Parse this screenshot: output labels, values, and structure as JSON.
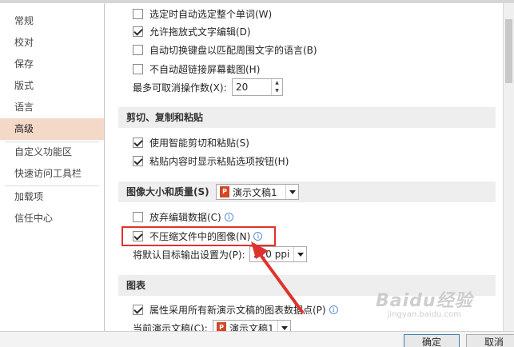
{
  "nav": {
    "items": [
      {
        "label": "常规"
      },
      {
        "label": "校对"
      },
      {
        "label": "保存"
      },
      {
        "label": "版式"
      },
      {
        "label": "语言"
      },
      {
        "label": "高级",
        "active": true
      },
      {
        "label": "自定义功能区"
      },
      {
        "label": "快速访问工具栏"
      },
      {
        "label": "加载项"
      },
      {
        "label": "信任中心"
      }
    ]
  },
  "editing": {
    "select_word": "选定时自动选定整个单词(W)",
    "drag_drop": "允许拖放式文字编辑(D)",
    "auto_keyboard": "自动切换键盘以匹配周围文字的语言(B)",
    "no_hyperlink_screenshot": "不自动超链接屏幕截图(H)",
    "max_undo_label": "最多可取消操作数(X):",
    "max_undo_value": "20"
  },
  "cut_copy_paste": {
    "header": "剪切、复制和粘贴",
    "smart_cut": "使用智能剪切和粘贴(S)",
    "show_paste_options": "粘贴内容时显示粘贴选项按钮(H)"
  },
  "image_size": {
    "header": "图像大小和质量(S)",
    "document": "演示文稿1",
    "discard_edit": "放弃编辑数据(C)",
    "no_compress": "不压缩文件中的图像(N)",
    "default_output_label": "将默认目标输出设置为(P):",
    "default_output_value": "220 ppi"
  },
  "chart": {
    "header": "图表",
    "properties_follow": "属性采用所有新演示文稿的图表数据点(P)",
    "current_label": "当前演示文稿(C):",
    "current_value": "演示文稿1"
  },
  "buttons": {
    "ok": "确定",
    "cancel": "取消"
  },
  "watermark": {
    "brand": "Baidu经验",
    "sub": "jingyan.baidu.com"
  },
  "colors": {
    "active_nav": "#f5d9c8",
    "highlight": "#e0322c"
  }
}
